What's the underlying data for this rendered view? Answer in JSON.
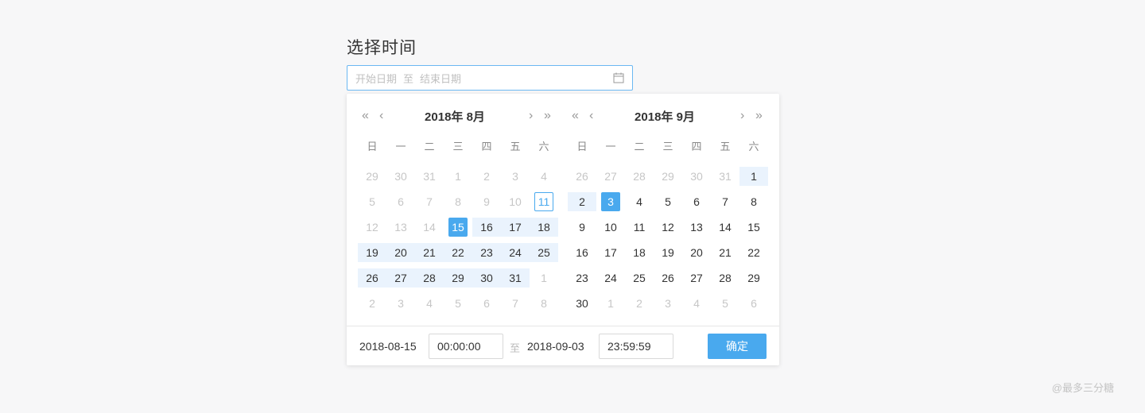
{
  "page": {
    "title": "选择时间",
    "watermark": "@最多三分糖"
  },
  "range_input": {
    "start_placeholder": "开始日期",
    "separator": "至",
    "end_placeholder": "结束日期",
    "icon": "calendar-icon"
  },
  "nav_icons": {
    "prev_year": "«",
    "prev_month": "‹",
    "next_month": "›",
    "next_year": "»"
  },
  "weekdays": [
    "日",
    "一",
    "二",
    "三",
    "四",
    "五",
    "六"
  ],
  "calendars": [
    {
      "month_label": "2018年 8月",
      "days": [
        [
          {
            "d": "29",
            "muted": true
          },
          {
            "d": "30",
            "muted": true
          },
          {
            "d": "31",
            "muted": true
          },
          {
            "d": "1",
            "muted": true
          },
          {
            "d": "2",
            "muted": true
          },
          {
            "d": "3",
            "muted": true
          },
          {
            "d": "4",
            "muted": true
          }
        ],
        [
          {
            "d": "5",
            "muted": true
          },
          {
            "d": "6",
            "muted": true
          },
          {
            "d": "7",
            "muted": true
          },
          {
            "d": "8",
            "muted": true
          },
          {
            "d": "9",
            "muted": true
          },
          {
            "d": "10",
            "muted": true
          },
          {
            "d": "11",
            "today": true
          }
        ],
        [
          {
            "d": "12",
            "muted": true
          },
          {
            "d": "13",
            "muted": true
          },
          {
            "d": "14",
            "muted": true
          },
          {
            "d": "15",
            "sel": true
          },
          {
            "d": "16",
            "inrange": true
          },
          {
            "d": "17",
            "inrange": true
          },
          {
            "d": "18",
            "inrange": true
          }
        ],
        [
          {
            "d": "19",
            "inrange": true
          },
          {
            "d": "20",
            "inrange": true
          },
          {
            "d": "21",
            "inrange": true
          },
          {
            "d": "22",
            "inrange": true
          },
          {
            "d": "23",
            "inrange": true
          },
          {
            "d": "24",
            "inrange": true
          },
          {
            "d": "25",
            "inrange": true
          }
        ],
        [
          {
            "d": "26",
            "inrange": true
          },
          {
            "d": "27",
            "inrange": true
          },
          {
            "d": "28",
            "inrange": true
          },
          {
            "d": "29",
            "inrange": true
          },
          {
            "d": "30",
            "inrange": true
          },
          {
            "d": "31",
            "inrange": true
          },
          {
            "d": "1",
            "muted": true
          }
        ],
        [
          {
            "d": "2",
            "muted": true
          },
          {
            "d": "3",
            "muted": true
          },
          {
            "d": "4",
            "muted": true
          },
          {
            "d": "5",
            "muted": true
          },
          {
            "d": "6",
            "muted": true
          },
          {
            "d": "7",
            "muted": true
          },
          {
            "d": "8",
            "muted": true
          }
        ]
      ]
    },
    {
      "month_label": "2018年 9月",
      "days": [
        [
          {
            "d": "26",
            "muted": true
          },
          {
            "d": "27",
            "muted": true
          },
          {
            "d": "28",
            "muted": true
          },
          {
            "d": "29",
            "muted": true
          },
          {
            "d": "30",
            "muted": true
          },
          {
            "d": "31",
            "muted": true
          },
          {
            "d": "1",
            "inrange": true
          }
        ],
        [
          {
            "d": "2",
            "inrange": true
          },
          {
            "d": "3",
            "sel": true
          },
          {
            "d": "4"
          },
          {
            "d": "5"
          },
          {
            "d": "6"
          },
          {
            "d": "7"
          },
          {
            "d": "8"
          }
        ],
        [
          {
            "d": "9"
          },
          {
            "d": "10"
          },
          {
            "d": "11"
          },
          {
            "d": "12"
          },
          {
            "d": "13"
          },
          {
            "d": "14"
          },
          {
            "d": "15"
          }
        ],
        [
          {
            "d": "16"
          },
          {
            "d": "17"
          },
          {
            "d": "18"
          },
          {
            "d": "19"
          },
          {
            "d": "20"
          },
          {
            "d": "21"
          },
          {
            "d": "22"
          }
        ],
        [
          {
            "d": "23"
          },
          {
            "d": "24"
          },
          {
            "d": "25"
          },
          {
            "d": "26"
          },
          {
            "d": "27"
          },
          {
            "d": "28"
          },
          {
            "d": "29"
          }
        ],
        [
          {
            "d": "30"
          },
          {
            "d": "1",
            "muted": true
          },
          {
            "d": "2",
            "muted": true
          },
          {
            "d": "3",
            "muted": true
          },
          {
            "d": "4",
            "muted": true
          },
          {
            "d": "5",
            "muted": true
          },
          {
            "d": "6",
            "muted": true
          }
        ]
      ]
    }
  ],
  "footer": {
    "start_date": "2018-08-15",
    "start_time": "00:00:00",
    "separator": "至",
    "end_date": "2018-09-03",
    "end_time": "23:59:59",
    "confirm_label": "确定"
  },
  "colors": {
    "accent": "#49a9ee",
    "range_bg": "#eaf3fd"
  }
}
